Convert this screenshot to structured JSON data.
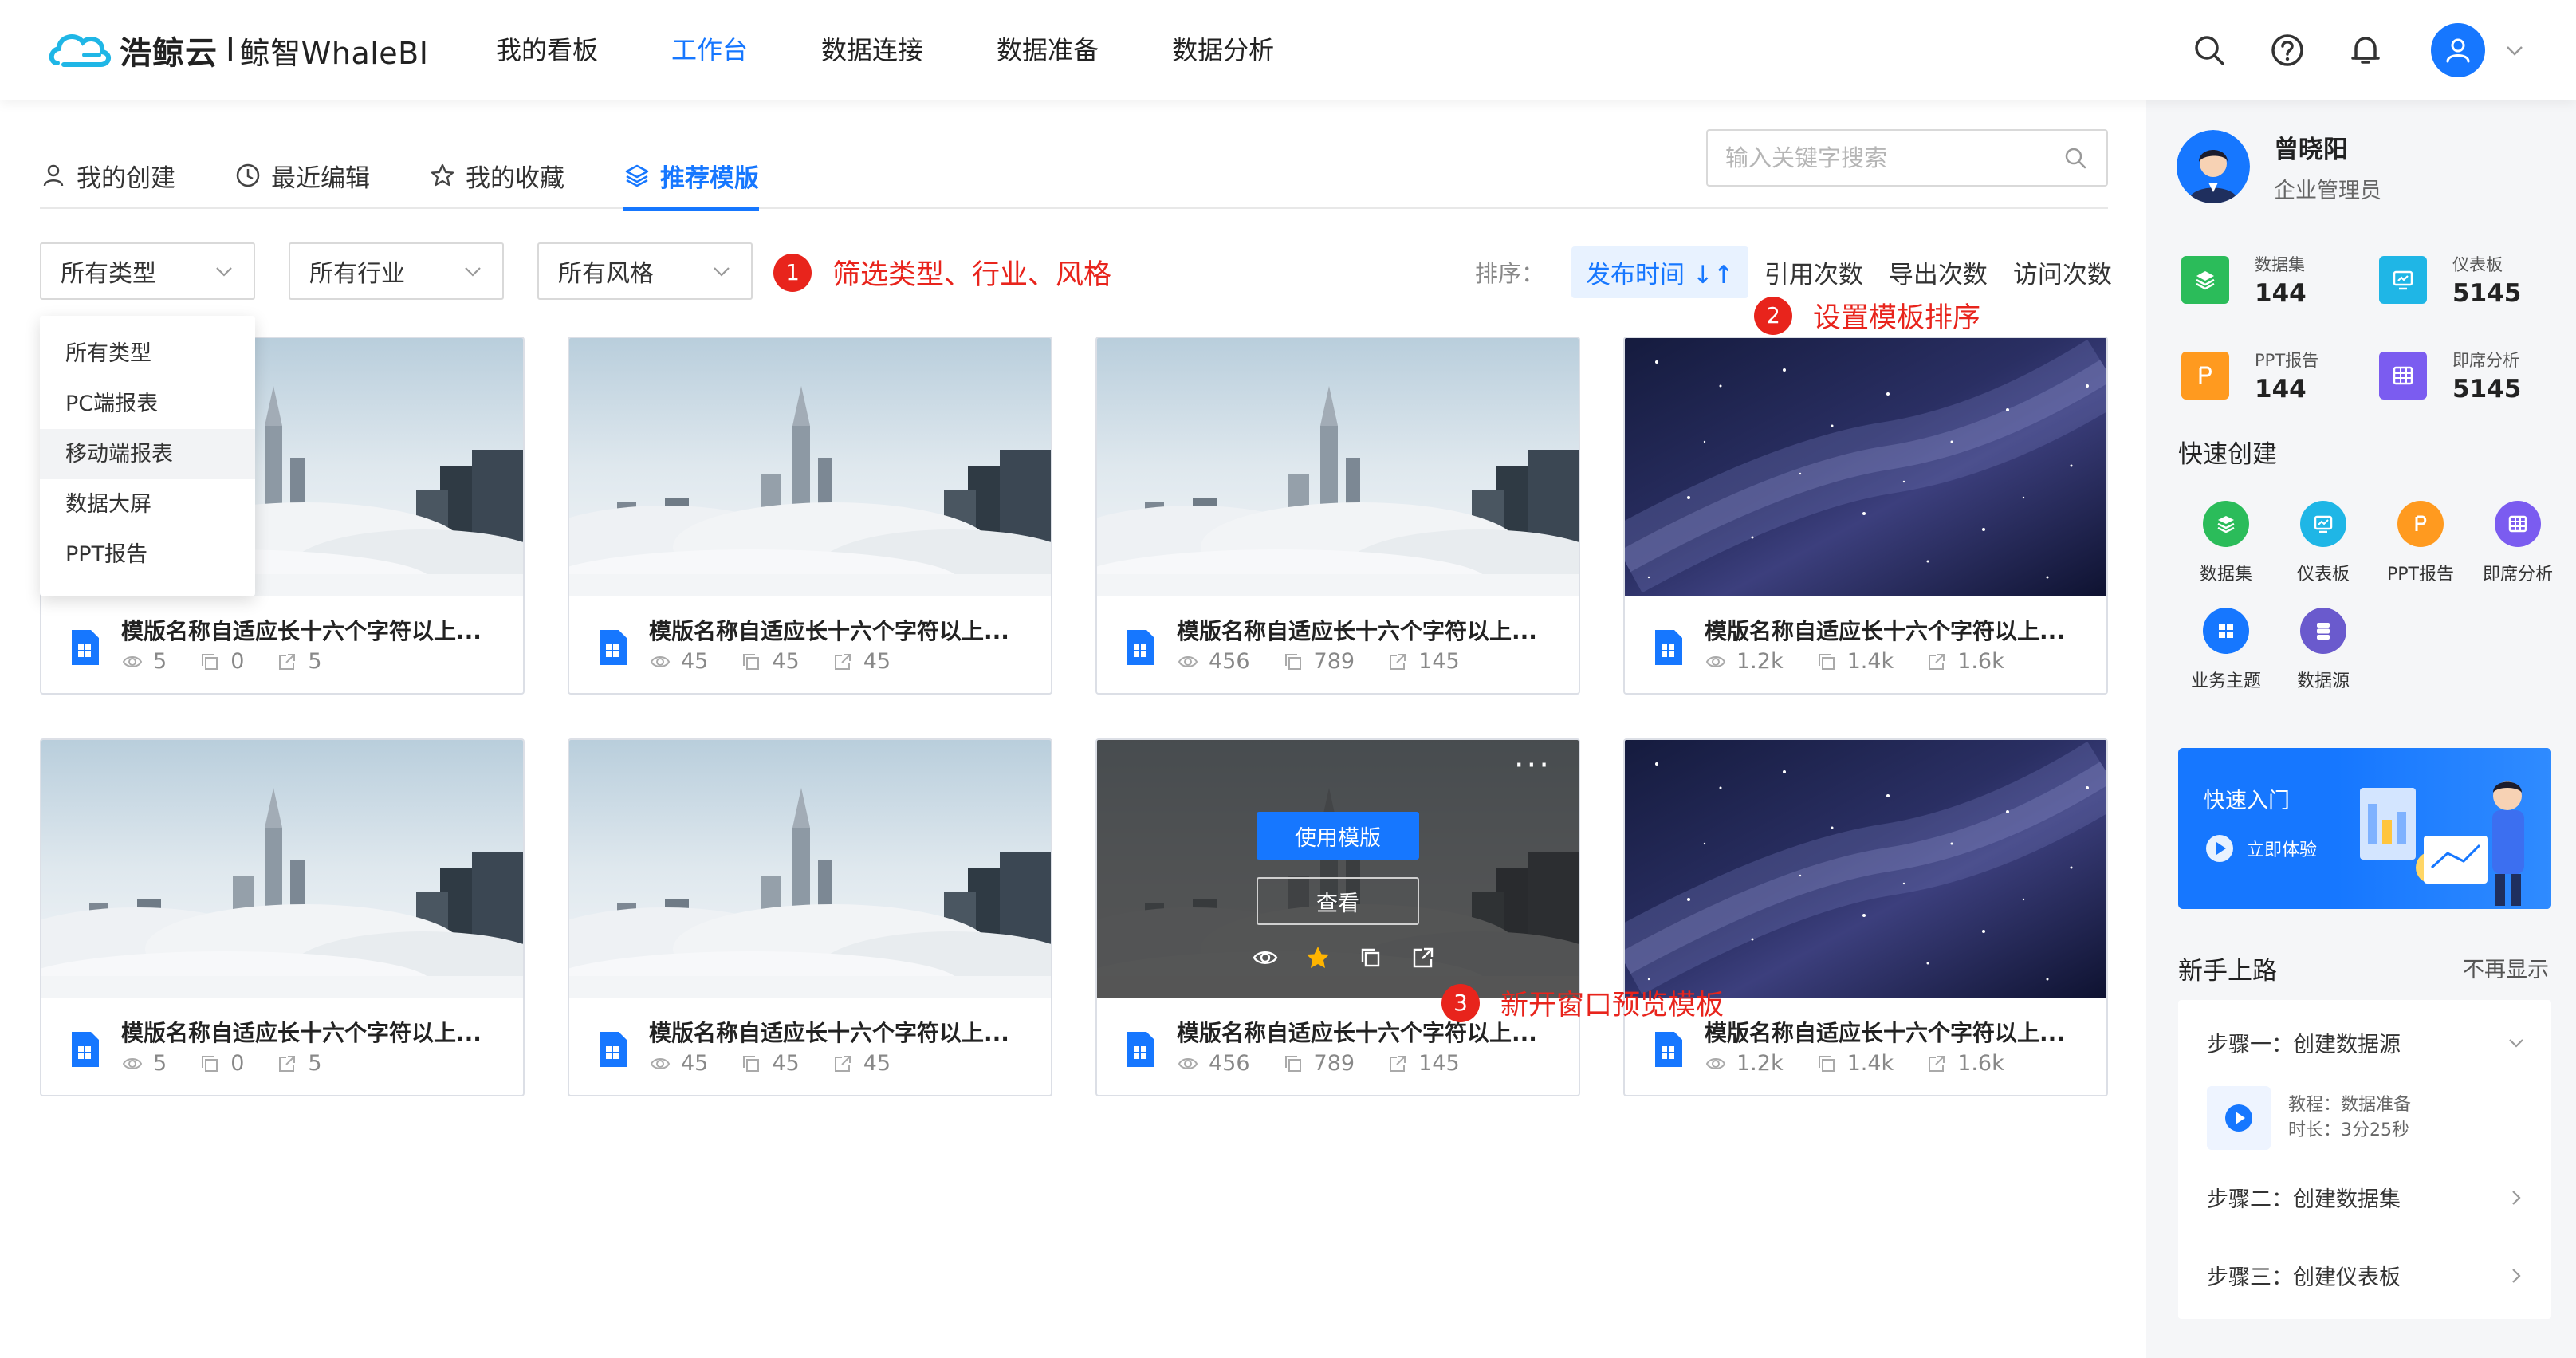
{
  "header": {
    "brand_name": "浩鲸云",
    "brand_sep": "I",
    "brand_sub": "鲸智WhaleBI",
    "nav": [
      "我的看板",
      "工作台",
      "数据连接",
      "数据准备",
      "数据分析"
    ],
    "active_nav": "工作台",
    "icons": [
      "search-icon",
      "help-icon",
      "bell-icon",
      "user-icon",
      "chevron-down-icon"
    ]
  },
  "tabs": [
    {
      "label": "我的创建",
      "icon": "user-icon"
    },
    {
      "label": "最近编辑",
      "icon": "clock-icon"
    },
    {
      "label": "我的收藏",
      "icon": "star-icon"
    },
    {
      "label": "推荐模版",
      "icon": "layers-icon",
      "active": true
    }
  ],
  "search": {
    "placeholder": "输入关键字搜索"
  },
  "filters": {
    "type": "所有类型",
    "industry": "所有行业",
    "style": "所有风格"
  },
  "type_dropdown": {
    "options": [
      "所有类型",
      "PC端报表",
      "移动端报表",
      "数据大屏",
      "PPT报告"
    ],
    "hovered": "移动端报表"
  },
  "sort": {
    "label": "排序：",
    "options": [
      "发布时间",
      "引用次数",
      "导出次数",
      "访问次数"
    ],
    "active": "发布时间"
  },
  "annotations": [
    {
      "num": "1",
      "text": "筛选类型、行业、风格"
    },
    {
      "num": "2",
      "text": "设置模板排序"
    },
    {
      "num": "3",
      "text": "新开窗口预览模板"
    }
  ],
  "cards": [
    {
      "title": "模版名称自适应长十六个字符以上...",
      "views": "5",
      "copies": "0",
      "exports": "5",
      "image": "city-fog"
    },
    {
      "title": "模版名称自适应长十六个字符以上...",
      "views": "45",
      "copies": "45",
      "exports": "45",
      "image": "city-fog"
    },
    {
      "title": "模版名称自适应长十六个字符以上...",
      "views": "456",
      "copies": "789",
      "exports": "145",
      "image": "city-fog"
    },
    {
      "title": "模版名称自适应长十六个字符以上...",
      "views": "1.2k",
      "copies": "1.4k",
      "exports": "1.6k",
      "image": "starry-sky"
    },
    {
      "title": "模版名称自适应长十六个字符以上...",
      "views": "5",
      "copies": "0",
      "exports": "5",
      "image": "city-fog"
    },
    {
      "title": "模版名称自适应长十六个字符以上...",
      "views": "45",
      "copies": "45",
      "exports": "45",
      "image": "city-fog"
    },
    {
      "title": "模版名称自适应长十六个字符以上...",
      "views": "456",
      "copies": "789",
      "exports": "145",
      "image": "city-fog",
      "hovered": true
    },
    {
      "title": "模版名称自适应长十六个字符以上...",
      "views": "1.2k",
      "copies": "1.4k",
      "exports": "1.6k",
      "image": "starry-sky"
    }
  ],
  "card_hover": {
    "use_label": "使用模版",
    "view_label": "查看",
    "more": "···"
  },
  "user": {
    "name": "曾晓阳",
    "role": "企业管理员"
  },
  "stats": [
    {
      "label": "数据集",
      "value": "144",
      "color": "#2bbc5a"
    },
    {
      "label": "仪表板",
      "value": "5145",
      "color": "#1fb6e6"
    },
    {
      "label": "PPT报告",
      "value": "144",
      "color": "#ff9a1f"
    },
    {
      "label": "即席分析",
      "value": "5145",
      "color": "#7b5cf0"
    }
  ],
  "quick_create": {
    "title": "快速创建",
    "items": [
      {
        "label": "数据集",
        "color": "#2bbc5a"
      },
      {
        "label": "仪表板",
        "color": "#1fb6e6"
      },
      {
        "label": "PPT报告",
        "color": "#ff9a1f"
      },
      {
        "label": "即席分析",
        "color": "#7b5cf0"
      },
      {
        "label": "业务主题",
        "color": "#1677ff"
      },
      {
        "label": "数据源",
        "color": "#6a5acd"
      }
    ]
  },
  "banner": {
    "title": "快速入门",
    "cta": "立即体验"
  },
  "guide": {
    "title": "新手上路",
    "hide_label": "不再显示",
    "steps": [
      "步骤一：创建数据源",
      "步骤二：创建数据集",
      "步骤三：创建仪表板"
    ],
    "tutorial": {
      "name": "教程：数据准备",
      "duration": "时长：3分25秒"
    }
  },
  "colors": {
    "accent": "#1677ff",
    "annotation": "#e8241c"
  }
}
